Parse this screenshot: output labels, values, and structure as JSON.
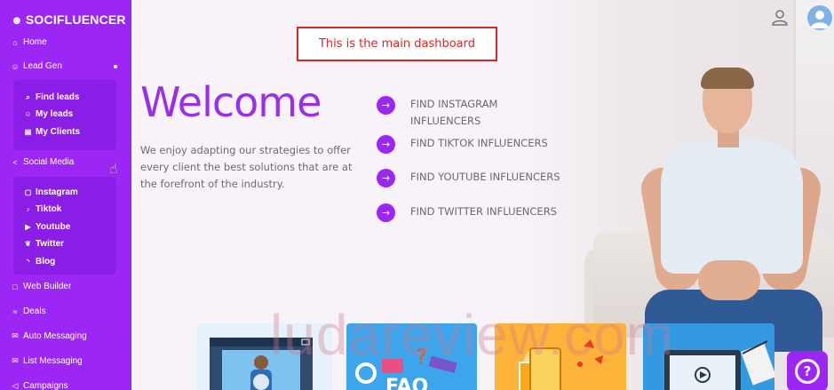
{
  "brand": {
    "logo_prefix": "SOCI",
    "logo_suffix": "FLUENCER",
    "accent_color": "#9c27f5"
  },
  "sidebar": {
    "items": [
      {
        "label": "Home",
        "icon": "home-icon"
      },
      {
        "label": "Lead Gen",
        "icon": "users-icon"
      },
      {
        "label": "Social Media",
        "icon": "share-icon"
      },
      {
        "label": "Web Builder",
        "icon": "layout-icon"
      },
      {
        "label": "Deals",
        "icon": "handshake-icon"
      },
      {
        "label": "Auto Messaging",
        "icon": "envelope-icon"
      },
      {
        "label": "List Messaging",
        "icon": "list-icon"
      },
      {
        "label": "Campaigns",
        "icon": "megaphone-icon"
      }
    ],
    "lead_gen_sub": [
      {
        "label": "Find leads",
        "icon": "search-icon"
      },
      {
        "label": "My leads",
        "icon": "users-icon"
      },
      {
        "label": "My Clients",
        "icon": "briefcase-icon"
      }
    ],
    "social_sub": [
      {
        "label": "Instagram",
        "icon": "instagram-icon"
      },
      {
        "label": "Tiktok",
        "icon": "tiktok-icon"
      },
      {
        "label": "Youtube",
        "icon": "youtube-icon"
      },
      {
        "label": "Twitter",
        "icon": "twitter-icon"
      },
      {
        "label": "Blog",
        "icon": "rss-icon"
      }
    ]
  },
  "annotation": {
    "text": "This is the main dashboard"
  },
  "hero": {
    "title": "Welcome",
    "tagline": "We enjoy adapting our strategies to offer every client the best solutions that are at the forefront of the industry."
  },
  "links": [
    {
      "label": "FIND INSTAGRAM INFLUENCERS"
    },
    {
      "label": "FIND TIKTOK INFLUENCERS"
    },
    {
      "label": "FIND YOUTUBE INFLUENCERS"
    },
    {
      "label": "FIND TWITTER INFLUENCERS"
    }
  ],
  "watermark": "ludareview.com",
  "help": {
    "glyph": "?"
  }
}
